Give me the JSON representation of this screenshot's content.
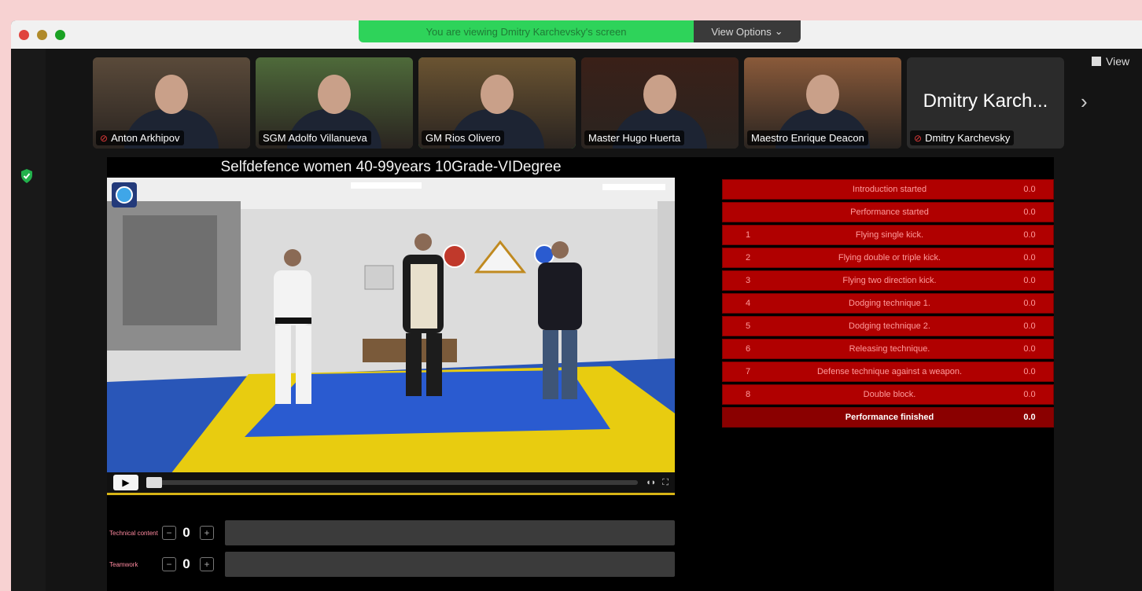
{
  "banner": {
    "sharing_text": "You are viewing Dmitry Karchevsky's screen",
    "view_options": "View Options",
    "view_options_icon": "chevron-down-icon"
  },
  "meeting": {
    "view_label": "View",
    "participants": [
      {
        "name": "Anton Arkhipov",
        "muted": true,
        "active": false,
        "tone": "#5a4a3a"
      },
      {
        "name": "SGM Adolfo Villanueva",
        "muted": false,
        "active": false,
        "tone": "#4e6a3a"
      },
      {
        "name": "GM Rios Olivero",
        "muted": false,
        "active": true,
        "tone": "#6b5432"
      },
      {
        "name": "Master Hugo Huerta",
        "muted": false,
        "active": false,
        "tone": "#3a2018"
      },
      {
        "name": "Maestro Enrique Deacon",
        "muted": false,
        "active": false,
        "tone": "#8a5a3a"
      },
      {
        "name": "Dmitry Karchevsky",
        "muted": true,
        "active": false,
        "tone": "#2b2b2b",
        "big_label": "Dmitry Karch..."
      }
    ]
  },
  "event": {
    "title": "Selfdefence women 40-99years 10Grade-VIDegree"
  },
  "scores": [
    {
      "label": "Technical content",
      "value": "0"
    },
    {
      "label": "Teamwork",
      "value": "0"
    }
  ],
  "techniques": [
    {
      "num": "",
      "desc": "Introduction started",
      "score": "0.0"
    },
    {
      "num": "",
      "desc": "Performance started",
      "score": "0.0"
    },
    {
      "num": "1",
      "desc": "Flying single kick.",
      "score": "0.0"
    },
    {
      "num": "2",
      "desc": "Flying double or triple kick.",
      "score": "0.0"
    },
    {
      "num": "3",
      "desc": "Flying two direction kick.",
      "score": "0.0"
    },
    {
      "num": "4",
      "desc": "Dodging technique 1.",
      "score": "0.0"
    },
    {
      "num": "5",
      "desc": "Dodging technique 2.",
      "score": "0.0"
    },
    {
      "num": "6",
      "desc": "Releasing technique.",
      "score": "0.0"
    },
    {
      "num": "7",
      "desc": "Defense technique against a weapon.",
      "score": "0.0"
    },
    {
      "num": "8",
      "desc": "Double block.",
      "score": "0.0"
    },
    {
      "num": "",
      "desc": "Performance finished",
      "score": "0.0"
    }
  ]
}
